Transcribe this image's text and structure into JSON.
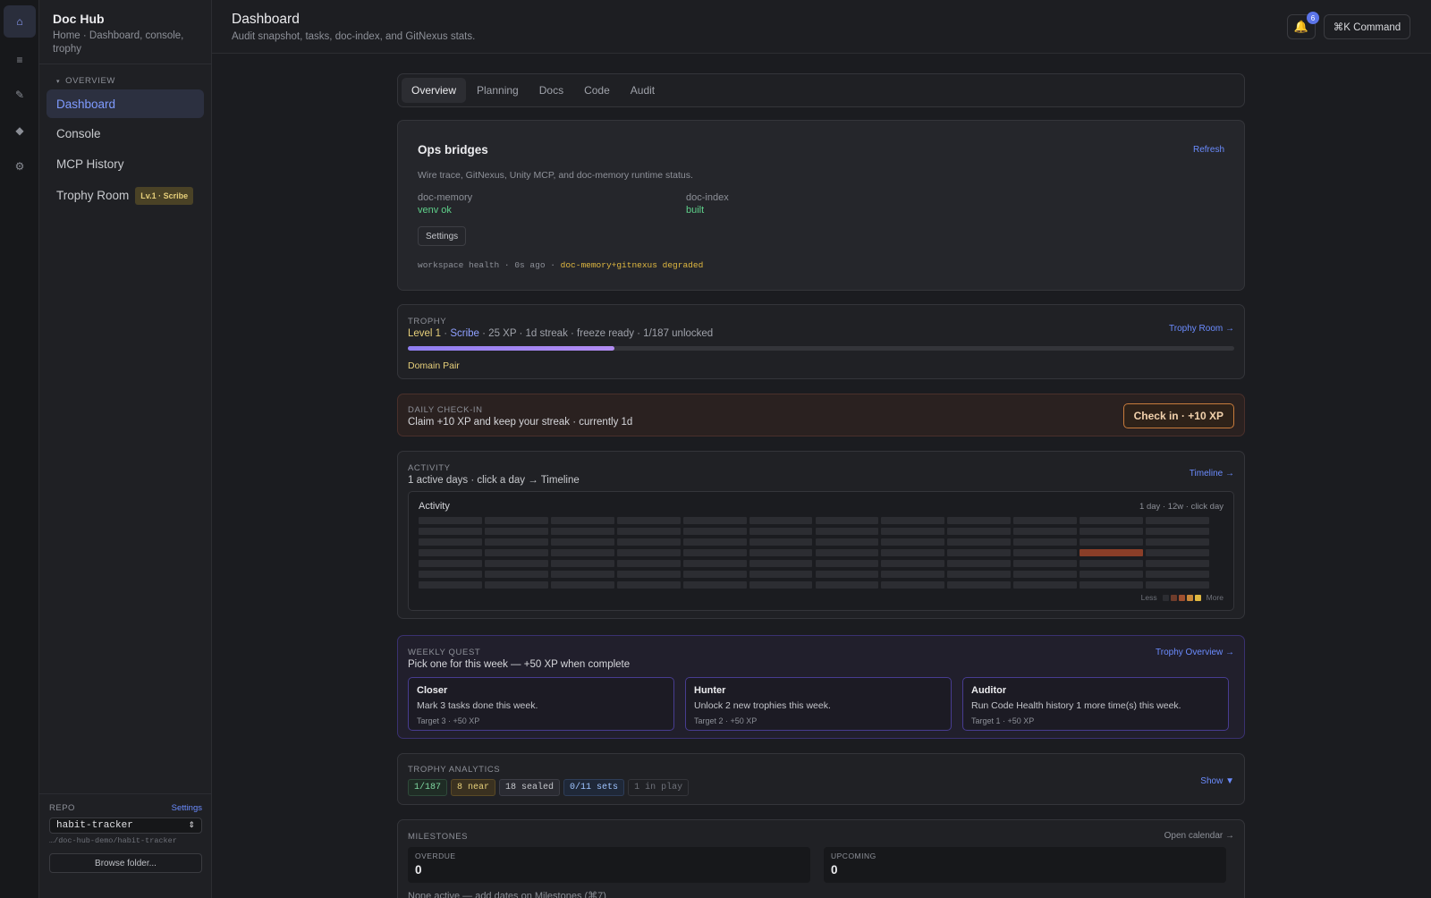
{
  "sidebar": {
    "title": "Doc Hub",
    "breadcrumb": "Home · Dashboard, console, trophy",
    "section": "OVERVIEW",
    "items": [
      {
        "label": "Dashboard"
      },
      {
        "label": "Console"
      },
      {
        "label": "MCP History"
      },
      {
        "label": "Trophy Room",
        "badge": "Lv.1 · Scribe"
      }
    ],
    "repo": {
      "label": "REPO",
      "settings": "Settings",
      "value": "habit-tracker",
      "path": "…/doc-hub-demo/habit-tracker",
      "browse": "Browse folder..."
    }
  },
  "rail": {
    "icons": [
      "home-icon",
      "menu-icon",
      "edit-icon",
      "diamond-icon",
      "gear-icon"
    ]
  },
  "header": {
    "title": "Dashboard",
    "subtitle": "Audit snapshot, tasks, doc-index, and GitNexus stats.",
    "notif_count": "6",
    "command": "⌘K Command"
  },
  "tabs": [
    "Overview",
    "Planning",
    "Docs",
    "Code",
    "Audit"
  ],
  "ops": {
    "title": "Ops bridges",
    "refresh": "Refresh",
    "desc": "Wire trace, GitNexus, Unity MCP, and doc-memory runtime status.",
    "items": [
      {
        "key": "doc-memory",
        "value": "venv ok"
      },
      {
        "key": "doc-index",
        "value": "built"
      }
    ],
    "settings": "Settings",
    "health_prefix": "workspace health · 0s ago ·",
    "health_status": "doc-memory+gitnexus degraded"
  },
  "trophy": {
    "label": "TROPHY",
    "level": "Level 1",
    "rank": "Scribe",
    "rest": "· 25 XP · 1d streak · freeze ready · 1/187 unlocked",
    "link": "Trophy Room →",
    "progress": 0.25,
    "domain": "Domain Pair"
  },
  "checkin": {
    "label": "DAILY CHECK-IN",
    "text": "Claim +10 XP and keep your streak · currently 1d",
    "button": "Check in · +10 XP"
  },
  "activity": {
    "label": "ACTIVITY",
    "sub": "1 active days · click a day → Timeline",
    "link": "Timeline →",
    "inner_title": "Activity",
    "meta": "1 day · 12w · click day",
    "weeks": 12,
    "days": 7,
    "active": [
      {
        "week": 10,
        "day": 3,
        "level": 3
      }
    ],
    "legend_less": "Less",
    "legend_more": "More",
    "colors": {
      "empty": "#2c2d32",
      "l1": "#6e3c2b",
      "l2": "#a0502f",
      "l3": "#c9893a",
      "l4": "#e0b840",
      "active": "#8a3e28"
    }
  },
  "quest": {
    "label": "WEEKLY QUEST",
    "sub": "Pick one for this week — +50 XP when complete",
    "link": "Trophy Overview →",
    "cards": [
      {
        "name": "Closer",
        "desc": "Mark 3 tasks done this week.",
        "meta": "Target 3 · +50 XP"
      },
      {
        "name": "Hunter",
        "desc": "Unlock 2 new trophies this week.",
        "meta": "Target 2 · +50 XP"
      },
      {
        "name": "Auditor",
        "desc": "Run Code Health history 1 more time(s) this week.",
        "meta": "Target 1 · +50 XP"
      }
    ]
  },
  "analytics": {
    "label": "TROPHY ANALYTICS",
    "show": "Show ▼",
    "pills": [
      {
        "text": "1/187",
        "color": "#7fd6a0",
        "bg": "#1f2c25",
        "border": "#2f4a3a"
      },
      {
        "text": "8 near",
        "color": "#e6cf7a",
        "bg": "#3a3120",
        "border": "#5a4a26"
      },
      {
        "text": "18 sealed",
        "color": "#c4c6cb",
        "bg": "#2a2b32",
        "border": "#3c3d46"
      },
      {
        "text": "0/11 sets",
        "color": "#9fc4ff",
        "bg": "#1f2838",
        "border": "#2e3d58"
      },
      {
        "text": "1 in play",
        "color": "#6e7179",
        "bg": "#202125",
        "border": "#34353a"
      }
    ]
  },
  "milestones": {
    "label": "MILESTONES",
    "link": "Open calendar →",
    "overdue_label": "OVERDUE",
    "overdue": "0",
    "upcoming_label": "UPCOMING",
    "upcoming": "0",
    "none": "None active — add dates on Milestones (⌘7)"
  }
}
